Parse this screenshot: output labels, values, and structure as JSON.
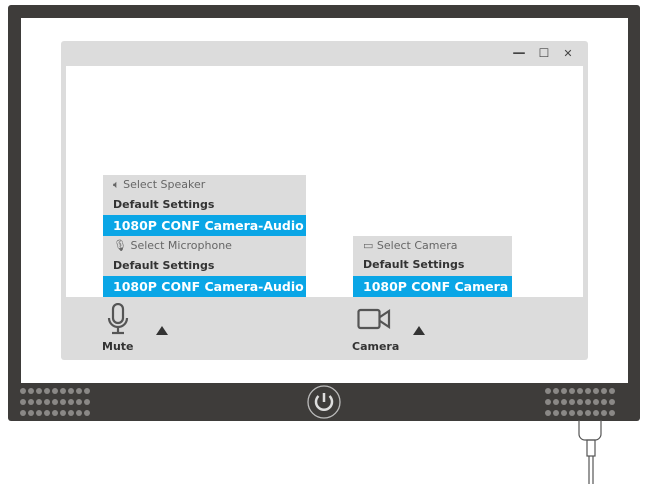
{
  "window": {
    "controls": [
      "minimize",
      "maximize",
      "close"
    ],
    "minimize": "—",
    "maximize": "☐",
    "close": "✕"
  },
  "speaker": {
    "header": "Select Speaker",
    "options": [
      "Default Settings",
      "1080P CONF Camera-Audio"
    ],
    "selected": "1080P CONF Camera-Audio"
  },
  "microphone": {
    "header": "Select Microphone",
    "options": [
      "Default Settings",
      "1080P CONF Camera-Audio"
    ],
    "selected": "1080P CONF Camera-Audio"
  },
  "camera": {
    "header": "Select Camera",
    "options": [
      "Default Settings",
      "1080P CONF Camera"
    ],
    "selected": "1080P CONF Camera"
  },
  "toolbar": {
    "mute_label": "Mute",
    "camera_label": "Camera"
  },
  "colors": {
    "frame": "#3e3c3a",
    "selected": "#0aa6e6",
    "panel": "#dcdcdc"
  }
}
